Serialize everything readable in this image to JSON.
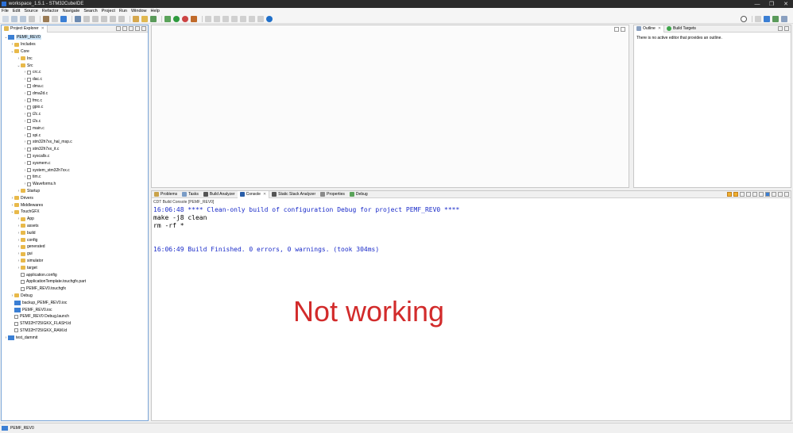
{
  "window": {
    "title": "workspace_1.5.1 - STM32CubeIDE",
    "controls": [
      "—",
      "❐",
      "✕"
    ]
  },
  "menu": [
    "File",
    "Edit",
    "Source",
    "Refactor",
    "Navigate",
    "Search",
    "Project",
    "Run",
    "Window",
    "Help"
  ],
  "project_explorer": {
    "tab_label": "Project Explorer",
    "rows": [
      {
        "label": "PEMF_REV0",
        "indent": 0,
        "twisty": "v",
        "icon": "proj",
        "selected": true
      },
      {
        "label": "Includes",
        "indent": 1,
        "twisty": ">",
        "icon": "folder"
      },
      {
        "label": "Core",
        "indent": 1,
        "twisty": "v",
        "icon": "folder"
      },
      {
        "label": "Inc",
        "indent": 2,
        "twisty": ">",
        "icon": "folder"
      },
      {
        "label": "Src",
        "indent": 2,
        "twisty": "v",
        "icon": "folder"
      },
      {
        "label": "crc.c",
        "indent": 3,
        "twisty": ">",
        "icon": "file"
      },
      {
        "label": "dac.c",
        "indent": 3,
        "twisty": ">",
        "icon": "file"
      },
      {
        "label": "dma.c",
        "indent": 3,
        "twisty": ">",
        "icon": "file"
      },
      {
        "label": "dma2d.c",
        "indent": 3,
        "twisty": ">",
        "icon": "file"
      },
      {
        "label": "fmc.c",
        "indent": 3,
        "twisty": ">",
        "icon": "file"
      },
      {
        "label": "gpio.c",
        "indent": 3,
        "twisty": ">",
        "icon": "file"
      },
      {
        "label": "i2c.c",
        "indent": 3,
        "twisty": ">",
        "icon": "file"
      },
      {
        "label": "i2s.c",
        "indent": 3,
        "twisty": ">",
        "icon": "file"
      },
      {
        "label": "main.c",
        "indent": 3,
        "twisty": ">",
        "icon": "file"
      },
      {
        "label": "spi.c",
        "indent": 3,
        "twisty": ">",
        "icon": "file"
      },
      {
        "label": "stm32h7xx_hal_msp.c",
        "indent": 3,
        "twisty": ">",
        "icon": "file"
      },
      {
        "label": "stm32h7xx_it.c",
        "indent": 3,
        "twisty": ">",
        "icon": "file"
      },
      {
        "label": "syscalls.c",
        "indent": 3,
        "twisty": ">",
        "icon": "file"
      },
      {
        "label": "sysmem.c",
        "indent": 3,
        "twisty": ">",
        "icon": "file"
      },
      {
        "label": "system_stm32h7xx.c",
        "indent": 3,
        "twisty": ">",
        "icon": "file"
      },
      {
        "label": "tim.c",
        "indent": 3,
        "twisty": ">",
        "icon": "file"
      },
      {
        "label": "Waveforms.h",
        "indent": 3,
        "twisty": ">",
        "icon": "file"
      },
      {
        "label": "Startup",
        "indent": 2,
        "twisty": ">",
        "icon": "folder"
      },
      {
        "label": "Drivers",
        "indent": 1,
        "twisty": ">",
        "icon": "folder"
      },
      {
        "label": "Middlewares",
        "indent": 1,
        "twisty": ">",
        "icon": "folder"
      },
      {
        "label": "TouchGFX",
        "indent": 1,
        "twisty": "v",
        "icon": "folder"
      },
      {
        "label": "App",
        "indent": 2,
        "twisty": ">",
        "icon": "folder"
      },
      {
        "label": "assets",
        "indent": 2,
        "twisty": ">",
        "icon": "folder"
      },
      {
        "label": "build",
        "indent": 2,
        "twisty": ">",
        "icon": "folder"
      },
      {
        "label": "config",
        "indent": 2,
        "twisty": ">",
        "icon": "folder"
      },
      {
        "label": "generated",
        "indent": 2,
        "twisty": ">",
        "icon": "folder"
      },
      {
        "label": "gui",
        "indent": 2,
        "twisty": ">",
        "icon": "folder"
      },
      {
        "label": "simulator",
        "indent": 2,
        "twisty": ">",
        "icon": "folder"
      },
      {
        "label": "target",
        "indent": 2,
        "twisty": ">",
        "icon": "folder"
      },
      {
        "label": "application.config",
        "indent": 2,
        "twisty": "",
        "icon": "file"
      },
      {
        "label": "ApplicationTemplate.touchgfx.part",
        "indent": 2,
        "twisty": "",
        "icon": "file"
      },
      {
        "label": "PEMF_REV0.touchgfx",
        "indent": 2,
        "twisty": "",
        "icon": "file"
      },
      {
        "label": "Debug",
        "indent": 1,
        "twisty": ">",
        "icon": "folder"
      },
      {
        "label": "backup_PEMF_REV0.ioc",
        "indent": 1,
        "twisty": "",
        "icon": "proj"
      },
      {
        "label": "PEMF_REV0.ioc",
        "indent": 1,
        "twisty": "",
        "icon": "proj"
      },
      {
        "label": "PEMF_REV0 Debug.launch",
        "indent": 1,
        "twisty": "",
        "icon": "file"
      },
      {
        "label": "STM32H725IGKX_FLASH.ld",
        "indent": 1,
        "twisty": "",
        "icon": "file"
      },
      {
        "label": "STM32H725IGKX_RAM.ld",
        "indent": 1,
        "twisty": "",
        "icon": "file"
      },
      {
        "label": "test_dammit",
        "indent": 0,
        "twisty": ">",
        "icon": "proj"
      }
    ]
  },
  "outline": {
    "tab_outline": "Outline",
    "tab_build_targets": "Build Targets",
    "message": "There is no active editor that provides an outline."
  },
  "console": {
    "tabs": [
      "Problems",
      "Tasks",
      "Build Analyzer",
      "Console",
      "Static Stack Analyzer",
      "Properties",
      "Debug"
    ],
    "active_tab": "Console",
    "header": "CDT Build Console [PEMF_REV0]",
    "lines": [
      {
        "text": "16:06:48 **** Clean-only build of configuration Debug for project PEMF_REV0 ****",
        "color": "blue"
      },
      {
        "text": "make -j8 clean",
        "color": "black"
      },
      {
        "text": "rm -rf *",
        "color": "black"
      },
      {
        "text": "",
        "color": "black"
      },
      {
        "text": "",
        "color": "black"
      },
      {
        "text": "16:06:49 Build Finished. 0 errors, 0 warnings. (took 304ms)",
        "color": "blue"
      }
    ],
    "annotation": "Not working"
  },
  "status": {
    "selected": "PEMF_REV0"
  },
  "colors": {
    "accent": "#3b7fd4",
    "console_blue": "#1a2bc9",
    "annotation_red": "#d22b2b"
  }
}
